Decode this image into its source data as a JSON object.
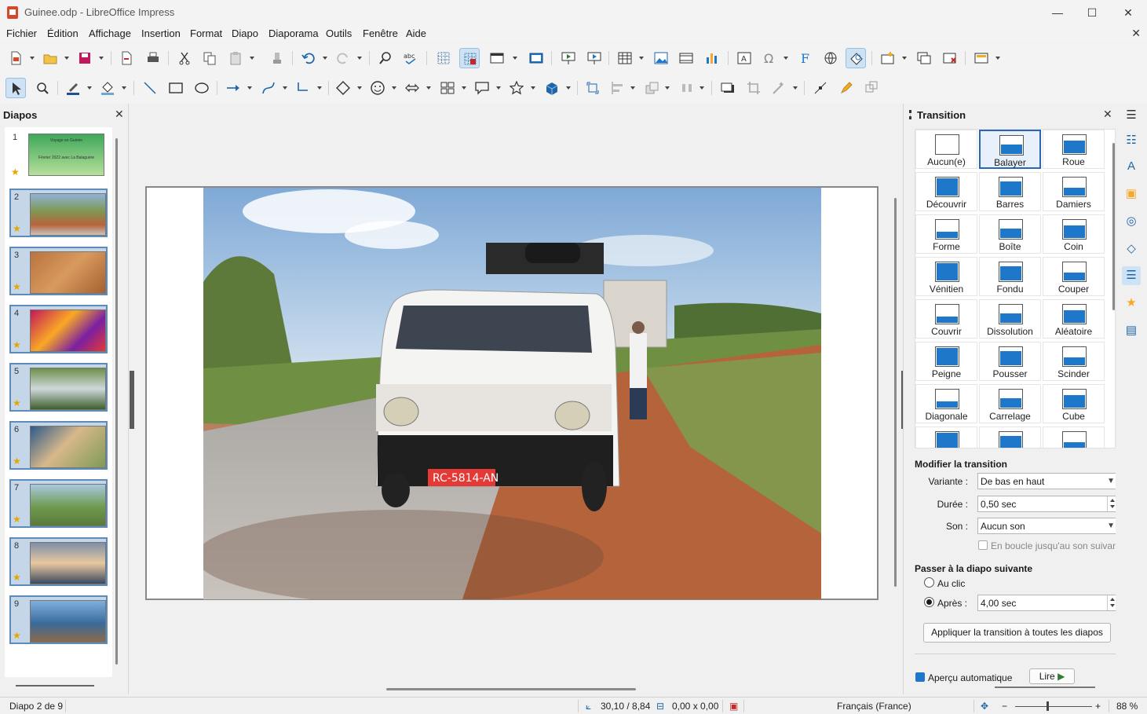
{
  "window": {
    "title": "Guinee.odp - LibreOffice Impress"
  },
  "menu": [
    "Fichier",
    "Édition",
    "Affichage",
    "Insertion",
    "Format",
    "Diapo",
    "Diaporama",
    "Outils",
    "Fenêtre",
    "Aide"
  ],
  "slides_panel": {
    "title": "Diapos",
    "first_slide_title": "Voyage en Guinée",
    "first_slide_subtitle": "Février 2022 avec La Balaguère",
    "items": [
      {
        "num": "1",
        "palette": "green"
      },
      {
        "num": "2",
        "palette": "road"
      },
      {
        "num": "3",
        "palette": "wood"
      },
      {
        "num": "4",
        "palette": "market"
      },
      {
        "num": "5",
        "palette": "river"
      },
      {
        "num": "6",
        "palette": "people"
      },
      {
        "num": "7",
        "palette": "hut"
      },
      {
        "num": "8",
        "palette": "sunset"
      },
      {
        "num": "9",
        "palette": "boat"
      }
    ],
    "selected": "2"
  },
  "sidebar": {
    "title": "Transition",
    "transitions": [
      "Aucun(e)",
      "Balayer",
      "Roue",
      "Découvrir",
      "Barres",
      "Damiers",
      "Forme",
      "Boîte",
      "Coin",
      "Vénitien",
      "Fondu",
      "Couper",
      "Couvrir",
      "Dissolution",
      "Aléatoire",
      "Peigne",
      "Pousser",
      "Scinder",
      "Diagonale",
      "Carrelage",
      "Cube"
    ],
    "selected_transition": "Balayer",
    "modify_heading": "Modifier la transition",
    "variant_label": "Variante :",
    "variant_value": "De bas en haut",
    "duration_label": "Durée :",
    "duration_value": "0,50 sec",
    "sound_label": "Son :",
    "sound_value": "Aucun son",
    "loop_label": "En boucle jusqu'au son suivant",
    "next_heading": "Passer à la diapo suivante",
    "on_click_label": "Au clic",
    "after_label": "Après :",
    "after_value": "4,00 sec",
    "apply_all_button": "Appliquer la transition à toutes les diapos",
    "auto_preview_label": "Aperçu automatique",
    "play_button": "Lire"
  },
  "statusbar": {
    "slide_info": "Diapo 2 de 9",
    "position": "30,10 / 8,84",
    "size": "0,00 x 0,00",
    "language": "Français (France)",
    "zoom": "88 %"
  },
  "colors": {
    "accent": "#1f77c9",
    "selection": "#cde3f5",
    "thumb_border": "#5f8bb8"
  }
}
